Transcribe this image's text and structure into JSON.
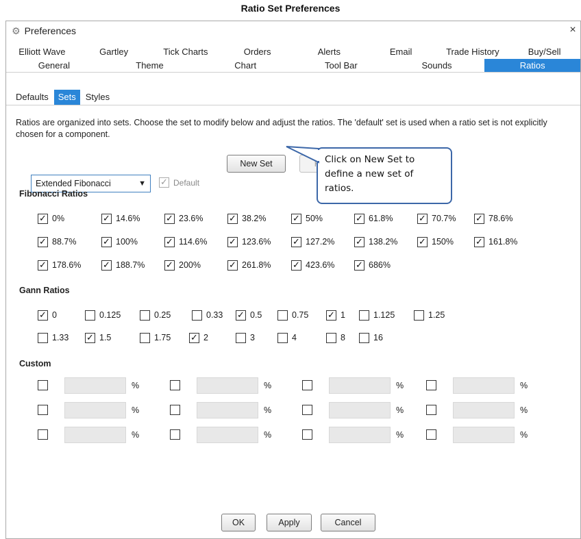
{
  "caption": "Ratio Set Preferences",
  "window": {
    "title": "Preferences",
    "close": "×"
  },
  "tabs_row1": [
    "Elliott Wave",
    "Gartley",
    "Tick Charts",
    "Orders",
    "Alerts",
    "Email",
    "Trade History",
    "Buy/Sell"
  ],
  "tabs_row2": [
    "General",
    "Theme",
    "Chart",
    "Tool Bar",
    "Sounds",
    "Ratios"
  ],
  "active_tab": "Ratios",
  "subtabs": [
    "Defaults",
    "Sets",
    "Styles"
  ],
  "active_subtab": "Sets",
  "description": "Ratios are organized into sets. Choose the set to modify below and adjust the ratios. The 'default' set is used when a ratio set is not explicitly chosen for a component.",
  "set_select": {
    "value": "Extended Fibonacci",
    "arrow": "▼"
  },
  "default_checkbox": {
    "label": "Default",
    "checked": true,
    "disabled": true
  },
  "buttons": {
    "new_set": "New Set",
    "remove": "Remove",
    "ok": "OK",
    "apply": "Apply",
    "cancel": "Cancel"
  },
  "callout": "Click on New Set to define a new set of ratios.",
  "fibonacci": {
    "title": "Fibonacci Ratios",
    "items": [
      {
        "label": "0%",
        "checked": true
      },
      {
        "label": "14.6%",
        "checked": true
      },
      {
        "label": "23.6%",
        "checked": true
      },
      {
        "label": "38.2%",
        "checked": true
      },
      {
        "label": "50%",
        "checked": true
      },
      {
        "label": "61.8%",
        "checked": true
      },
      {
        "label": "70.7%",
        "checked": true
      },
      {
        "label": "78.6%",
        "checked": true
      },
      {
        "label": "88.7%",
        "checked": true
      },
      {
        "label": "100%",
        "checked": true
      },
      {
        "label": "114.6%",
        "checked": true
      },
      {
        "label": "123.6%",
        "checked": true
      },
      {
        "label": "127.2%",
        "checked": true
      },
      {
        "label": "138.2%",
        "checked": true
      },
      {
        "label": "150%",
        "checked": true
      },
      {
        "label": "161.8%",
        "checked": true
      },
      {
        "label": "178.6%",
        "checked": true
      },
      {
        "label": "188.7%",
        "checked": true
      },
      {
        "label": "200%",
        "checked": true
      },
      {
        "label": "261.8%",
        "checked": true
      },
      {
        "label": "423.6%",
        "checked": true
      },
      {
        "label": "686%",
        "checked": true
      }
    ]
  },
  "gann": {
    "title": "Gann Ratios",
    "items": [
      {
        "label": "0",
        "checked": true
      },
      {
        "label": "0.125",
        "checked": false
      },
      {
        "label": "0.25",
        "checked": false
      },
      {
        "label": "0.33",
        "checked": false
      },
      {
        "label": "0.5",
        "checked": true
      },
      {
        "label": "0.75",
        "checked": false
      },
      {
        "label": "1",
        "checked": true
      },
      {
        "label": "1.125",
        "checked": false
      },
      {
        "label": "1.25",
        "checked": false
      },
      {
        "label": "1.33",
        "checked": false
      },
      {
        "label": "1.5",
        "checked": true
      },
      {
        "label": "1.75",
        "checked": false
      },
      {
        "label": "2",
        "checked": true
      },
      {
        "label": "3",
        "checked": false
      },
      {
        "label": "4",
        "checked": false
      },
      {
        "label": "8",
        "checked": false
      },
      {
        "label": "16",
        "checked": false
      }
    ]
  },
  "custom": {
    "title": "Custom",
    "unit": "%"
  },
  "colors": {
    "accent": "#2a86d8",
    "callout_border": "#3c67a8"
  }
}
